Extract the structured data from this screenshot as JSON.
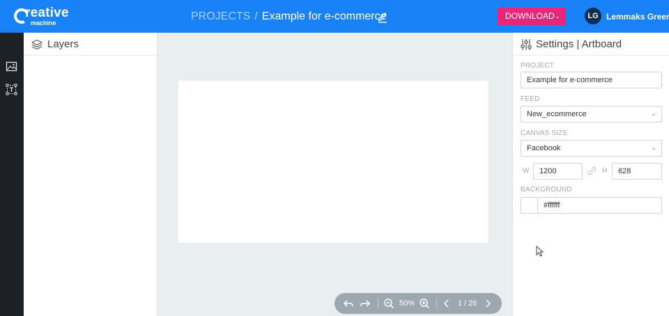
{
  "brand": {
    "line1": "reative",
    "line2": "machine"
  },
  "header": {
    "breadcrumb_root": "PROJECTS",
    "breadcrumb_sep": "/",
    "project_name": "Example for e-commerce",
    "download_label": "DOWNLOAD",
    "user_initials": "LG",
    "user_name": "Lemmaks Green"
  },
  "layers": {
    "title": "Layers"
  },
  "settings": {
    "title": "Settings | Artboard",
    "project_label": "PROJECT",
    "project_value": "Example for e-commerce",
    "feed_label": "FEED",
    "feed_value": "New_ecommerce",
    "canvas_size_label": "CANVAS SIZE",
    "canvas_size_value": "Facebook",
    "w_label": "W",
    "w_value": "1200",
    "h_label": "H",
    "h_value": "628",
    "background_label": "BACKGROUND",
    "background_value": "#ffffff"
  },
  "toolbar": {
    "zoom": "50%",
    "page": "1 / 26"
  },
  "colors": {
    "accent": "#1a82f7",
    "download": "#e8267a",
    "rail": "#1d2126",
    "canvas_bg": "#e9eef1"
  }
}
